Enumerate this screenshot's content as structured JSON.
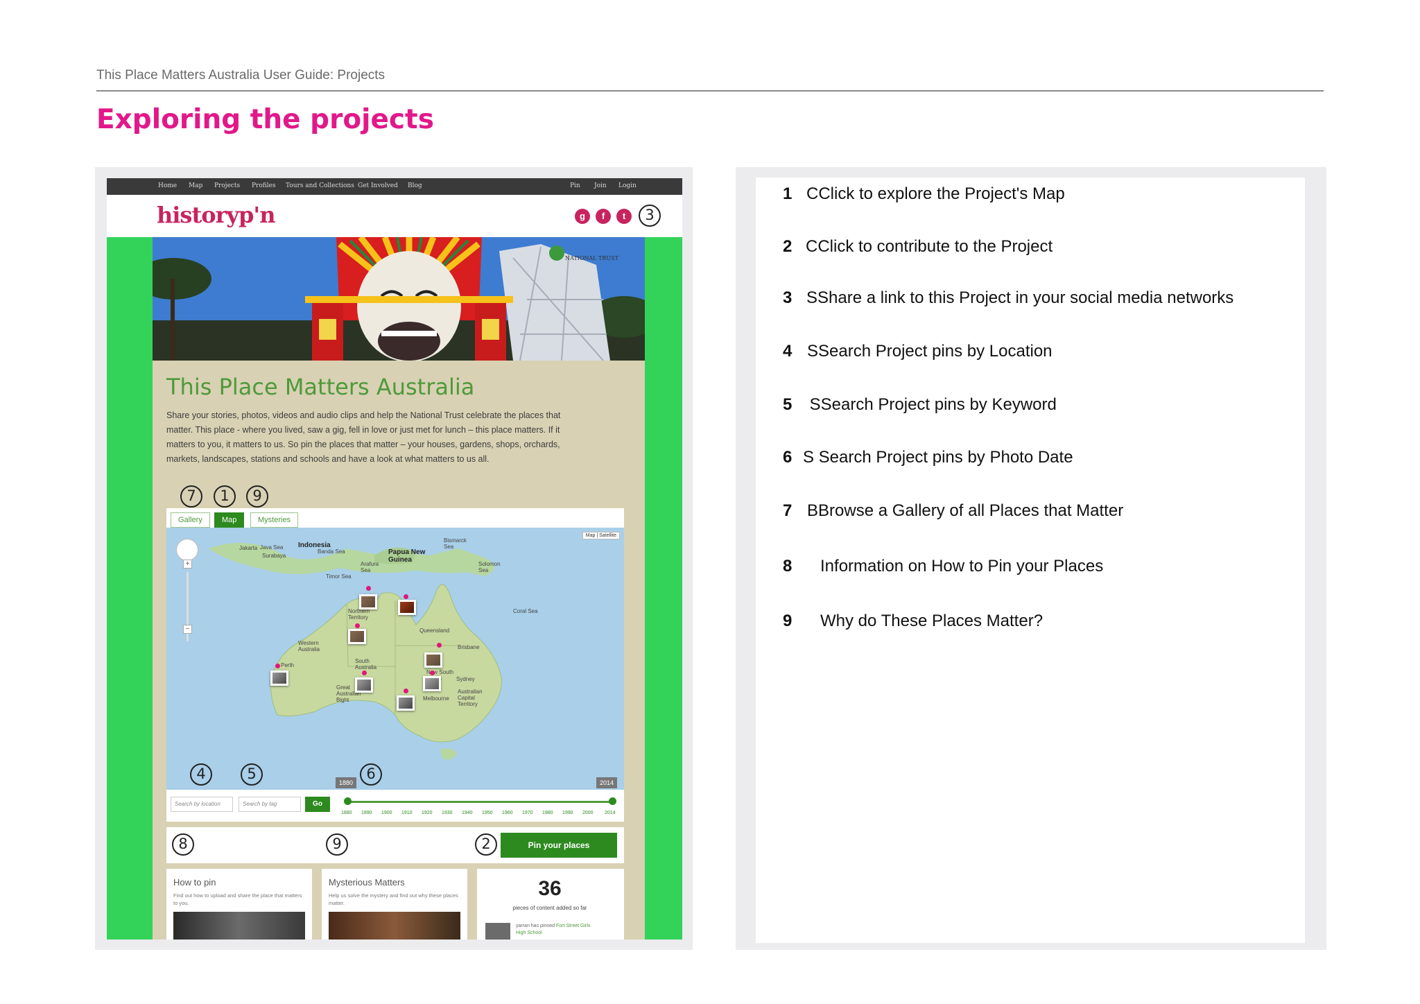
{
  "header": {
    "running_title": "This Place Matters Australia User Guide: Projects"
  },
  "page_title": "Exploring the projects",
  "screenshot": {
    "nav": [
      "Home",
      "Map",
      "Projects",
      "Profiles",
      "Tours and Collections",
      "Get Involved",
      "Blog"
    ],
    "nav_right": [
      "Pin",
      "Join",
      "Login"
    ],
    "logo": "historyp'n",
    "banner_logo": "NATIONAL TRUST",
    "site_title": "This Place Matters Australia",
    "site_description": "Share your stories, photos, videos and audio clips and help the National Trust celebrate the places that matter. This place - where you lived, saw a gig, fell in love or just met for lunch – this place matters. If it matters to you, it matters to us. So pin the places that matter – your houses, gardens, shops, orchards, markets, landscapes, stations and schools and have a look at what matters to us all.",
    "tabs": [
      "Gallery",
      "Map",
      "Mysteries"
    ],
    "map_toggle": "Map | Satellite",
    "map_labels": {
      "indonesia": "Indonesia",
      "png": "Papua New Guinea",
      "jakarta": "Jakarta",
      "java_sea": "Java Sea",
      "surabaya": "Surabaya",
      "banda_sea": "Banda Sea",
      "bismarck": "Bismarck Sea",
      "solomon": "Solomon Sea",
      "arafura": "Arafura Sea",
      "timor": "Timor Sea",
      "coral": "Coral Sea",
      "nt": "Northern Territory",
      "qld": "Queensland",
      "wa": "Western Australia",
      "sa": "South Australia",
      "nsw": "New South Wales",
      "bight": "Great Australian Bight",
      "brisbane": "Brisbane",
      "sydney": "Sydney",
      "act": "Australian Capital Territory",
      "melbourne": "Melbourne",
      "perth": "Perth"
    },
    "search_location_placeholder": "Search by location",
    "search_tag_placeholder": "Search by tag",
    "go": "Go",
    "timeline_start": "1880",
    "timeline_end": "2014",
    "timeline_years": [
      "1880",
      "1890",
      "1900",
      "1910",
      "1920",
      "1930",
      "1940",
      "1950",
      "1960",
      "1970",
      "1980",
      "1990",
      "2000",
      "2014"
    ],
    "pin_button": "Pin your places",
    "card_how": {
      "title": "How to pin",
      "text": "Find out how to upload and share the place that matters to you."
    },
    "card_mystery": {
      "title": "Mysterious Matters",
      "text": "Help us solve the mystery and find out why these places matter."
    },
    "card_count": {
      "value": "36",
      "label": "pieces of content added so far",
      "recent_user": "yarran has pinned",
      "recent_place": "Fort Street Girls High School"
    },
    "callouts": [
      "1",
      "2",
      "3",
      "4",
      "5",
      "6",
      "7",
      "8",
      "9"
    ]
  },
  "legend": [
    {
      "num": "1",
      "text": "CClick to explore the Project's Map"
    },
    {
      "num": "2",
      "text": "CClick to contribute to the Project"
    },
    {
      "num": "3",
      "text": "SShare a link to this Project in your social media networks"
    },
    {
      "num": "4",
      "text": "SSearch Project pins by Location"
    },
    {
      "num": "5",
      "text": " SSearch Project pins by Keyword"
    },
    {
      "num": "6",
      "text": "S Search Project pins by Photo Date"
    },
    {
      "num": "7",
      "text": "BBrowse a Gallery of all Places that Matter"
    },
    {
      "num": "8",
      "text": "   Information on How to Pin your Places"
    },
    {
      "num": "9",
      "text": "   Why do These Places Matter?"
    }
  ],
  "colors": {
    "title_pink": "#e2188a",
    "site_green": "#33d35a",
    "button_green": "#2d8a1f",
    "brand": "#c8245d"
  }
}
